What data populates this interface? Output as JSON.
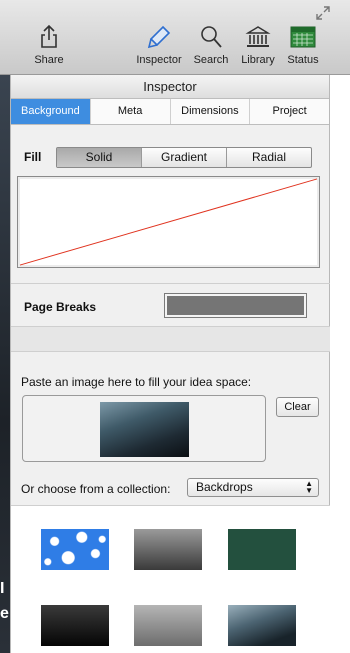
{
  "toolbar": {
    "share_label": "Share",
    "inspector_label": "Inspector",
    "search_label": "Search",
    "library_label": "Library",
    "status_label": "Status"
  },
  "panel": {
    "title": "Inspector",
    "tabs": [
      {
        "label": "Background",
        "active": true
      },
      {
        "label": "Meta",
        "active": false
      },
      {
        "label": "Dimensions",
        "active": false
      },
      {
        "label": "Project",
        "active": false
      }
    ]
  },
  "fill": {
    "label": "Fill",
    "options": [
      "Solid",
      "Gradient",
      "Radial"
    ],
    "selected": "Solid"
  },
  "page_breaks": {
    "label": "Page Breaks",
    "color": "#757575"
  },
  "paste": {
    "label": "Paste an image here to fill your idea space:",
    "clear_label": "Clear"
  },
  "collection": {
    "label": "Or choose from a collection:",
    "selected": "Backdrops"
  },
  "left_fragments": [
    "I",
    "e"
  ],
  "colors": {
    "accent": "#3e8de0",
    "gradient_line": "#e0331f",
    "thumb_green": "#23503e",
    "thumb_blue": "#2f7de6"
  }
}
